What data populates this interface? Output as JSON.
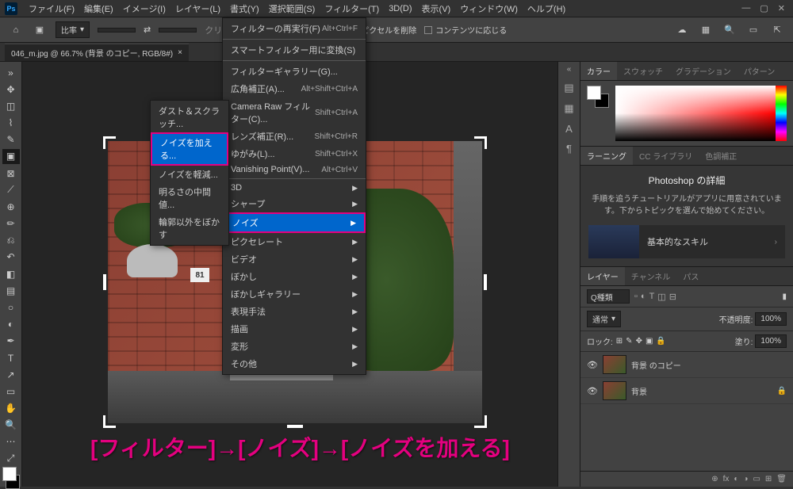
{
  "titlebar": {
    "menus": [
      "ファイル(F)",
      "編集(E)",
      "イメージ(I)",
      "レイヤー(L)",
      "書式(Y)",
      "選択範囲(S)",
      "フィルター(T)",
      "3D(D)",
      "表示(V)",
      "ウィンドウ(W)",
      "ヘルプ(H)"
    ]
  },
  "toolbar": {
    "ratio_label": "比率",
    "delete_pixels": "切り抜いたピクセルを削除",
    "content_aware": "コンテンツに応じる"
  },
  "doc_tab": "046_m.jpg @ 66.7% (背景 のコピー, RGB/8#)",
  "house_number": "81",
  "filter_menu": {
    "reapply": {
      "label": "フィルターの再実行(F)",
      "shortcut": "Alt+Ctrl+F"
    },
    "smart_convert": "スマートフィルター用に変換(S)",
    "filter_gallery": "フィルターギャラリー(G)...",
    "wide_angle": {
      "label": "広角補正(A)...",
      "shortcut": "Alt+Shift+Ctrl+A"
    },
    "camera_raw": {
      "label": "Camera Raw フィルター(C)...",
      "shortcut": "Shift+Ctrl+A"
    },
    "lens": {
      "label": "レンズ補正(R)...",
      "shortcut": "Shift+Ctrl+R"
    },
    "liquify": {
      "label": "ゆがみ(L)...",
      "shortcut": "Shift+Ctrl+X"
    },
    "vanishing": {
      "label": "Vanishing Point(V)...",
      "shortcut": "Alt+Ctrl+V"
    },
    "cat_3d": "3D",
    "cat_sharpen": "シャープ",
    "cat_noise": "ノイズ",
    "cat_pixelate": "ピクセレート",
    "cat_video": "ビデオ",
    "cat_blur": "ぼかし",
    "cat_blur_gallery": "ぼかしギャラリー",
    "cat_render": "表現手法",
    "cat_stylize": "描画",
    "cat_distort": "変形",
    "cat_other": "その他"
  },
  "noise_submenu": {
    "dust": "ダスト＆スクラッチ...",
    "add_noise": "ノイズを加える...",
    "reduce_noise": "ノイズを軽減...",
    "median": "明るさの中間値...",
    "despeckle": "輪郭以外をぼかす"
  },
  "panels": {
    "color_tabs": [
      "カラー",
      "スウォッチ",
      "グラデーション",
      "パターン"
    ],
    "learn_tabs": [
      "ラーニング",
      "CC ライブラリ",
      "色調補正"
    ],
    "learn_title": "Photoshop の詳細",
    "learn_text": "手順を追うチュートリアルがアプリに用意されています。下からトピックを選んで始めてください。",
    "learn_card": "基本的なスキル",
    "layer_tabs": [
      "レイヤー",
      "チャンネル",
      "パス"
    ],
    "layer_kind": "Q種類",
    "blend_mode": "通常",
    "opacity_label": "不透明度:",
    "opacity_val": "100%",
    "lock_label": "ロック:",
    "fill_label": "塗り:",
    "fill_val": "100%",
    "layer1": "背景 のコピー",
    "layer2": "背景"
  },
  "annotation": "[フィルター]→[ノイズ]→[ノイズを加える]"
}
